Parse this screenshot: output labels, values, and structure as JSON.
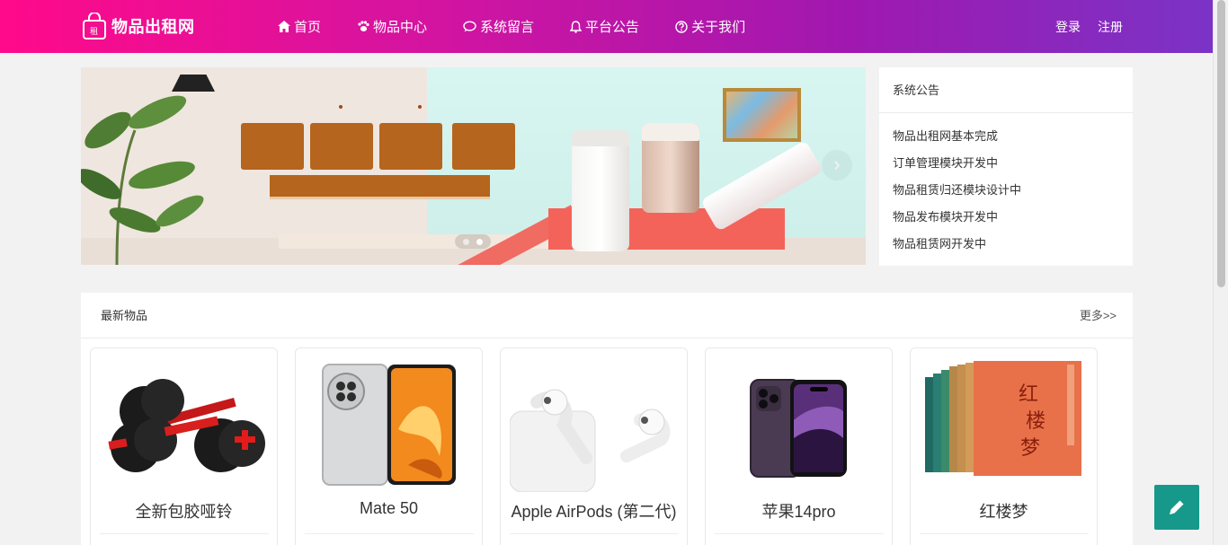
{
  "header": {
    "logo_text": "物品出租网",
    "logo_badge": "租",
    "nav": [
      {
        "label": "首页",
        "icon": "home-icon"
      },
      {
        "label": "物品中心",
        "icon": "paw-icon"
      },
      {
        "label": "系统留言",
        "icon": "comment-icon"
      },
      {
        "label": "平台公告",
        "icon": "bell-icon"
      },
      {
        "label": "关于我们",
        "icon": "question-circle-icon"
      }
    ],
    "login": "登录",
    "register": "注册"
  },
  "banner": {
    "next_arrow": "›",
    "slide_count": 2,
    "active_slide": 2
  },
  "notice": {
    "title": "系统公告",
    "items": [
      "物品出租网基本完成",
      "订单管理模块开发中",
      "物品租赁归还模块设计中",
      "物品发布模块开发中",
      "物品租赁网开发中"
    ]
  },
  "latest": {
    "title": "最新物品",
    "more": "更多>>",
    "products": [
      {
        "name": "全新包胶哑铃",
        "image": "dumbbell-image"
      },
      {
        "name": "Mate 50",
        "image": "phone-image"
      },
      {
        "name": "Apple AirPods (第二代)",
        "image": "earbuds-image"
      },
      {
        "name": "苹果14pro",
        "image": "iphone-image"
      },
      {
        "name": "红楼梦",
        "image": "book-set-image"
      }
    ]
  },
  "colors": {
    "header_start": "#ff0a8a",
    "header_end": "#7b33c6",
    "fab": "#16998b"
  },
  "fab_icon": "pencil-icon"
}
